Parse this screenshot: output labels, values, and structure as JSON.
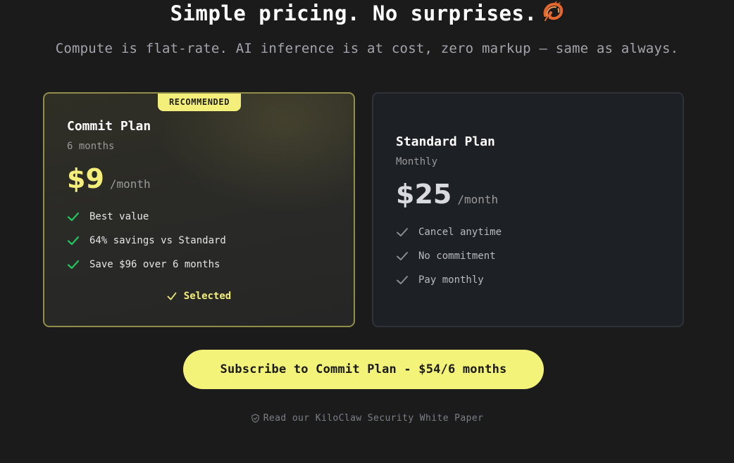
{
  "hero": {
    "title": "Simple pricing. No surprises.",
    "title_emoji_icon": "shrimp-icon",
    "subtitle": "Compute is flat-rate. AI inference is at cost, zero markup — same as always."
  },
  "plans": [
    {
      "badge": "RECOMMENDED",
      "name": "Commit Plan",
      "term": "6 months",
      "price": "$9",
      "per": "/month",
      "features": [
        "Best value",
        "64% savings vs Standard",
        "Save $96 over 6 months"
      ],
      "selected_label": "Selected",
      "selected": true,
      "accent_color": "#f4ef7a",
      "check_color": "#22c55e"
    },
    {
      "name": "Standard Plan",
      "term": "Monthly",
      "price": "$25",
      "per": "/month",
      "features": [
        "Cancel anytime",
        "No commitment",
        "Pay monthly"
      ],
      "selected": false,
      "check_color": "#8a8c92"
    }
  ],
  "cta": {
    "label": "Subscribe to Commit Plan - $54/6 months",
    "color": "#f4f379"
  },
  "footer": {
    "security_link": "Read our KiloClaw Security White Paper",
    "security_icon": "shield-check-icon"
  }
}
